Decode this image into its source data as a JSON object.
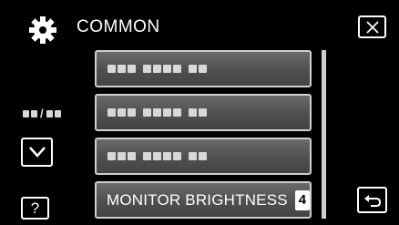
{
  "header": {
    "title": "COMMON",
    "icon": "gear-icon"
  },
  "menu": {
    "items": [
      {
        "label": "",
        "value": ""
      },
      {
        "label": "",
        "value": ""
      },
      {
        "label": "",
        "value": ""
      },
      {
        "label": "MONITOR BRIGHTNESS",
        "value": "4"
      }
    ]
  },
  "nav": {
    "page_separator": "/",
    "help_label": "?",
    "close_icon": "close-icon",
    "down_icon": "chevron-down-icon",
    "back_icon": "return-icon"
  },
  "colors": {
    "background": "#000000",
    "item_fill": "#555555",
    "item_border": "#cfcfcf",
    "text": "#ffffff"
  }
}
